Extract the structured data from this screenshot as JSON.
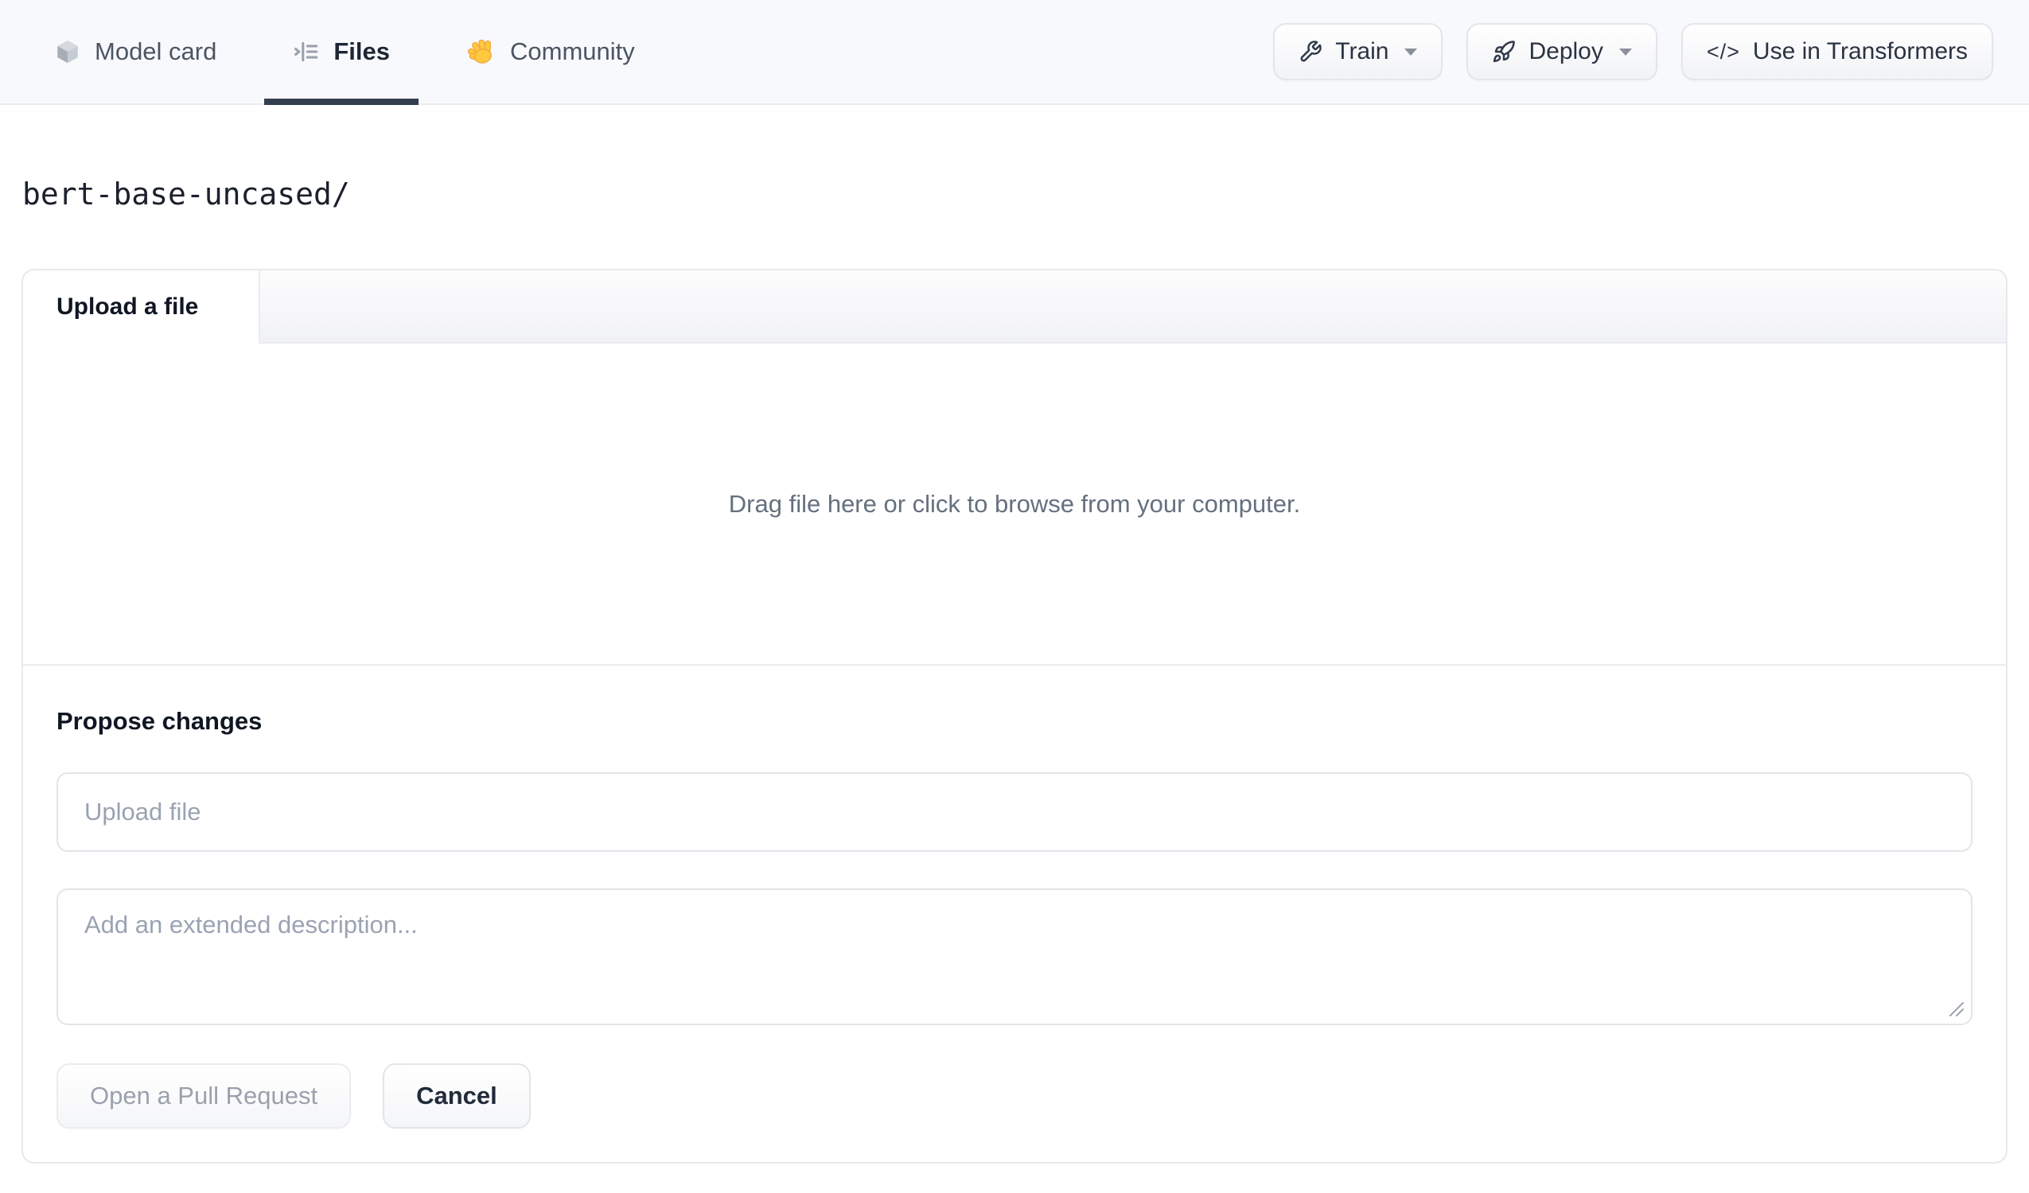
{
  "header": {
    "tabs": [
      {
        "label": "Model card",
        "icon": "cube-icon",
        "active": false
      },
      {
        "label": "Files",
        "icon": "file-tree-icon",
        "active": true
      },
      {
        "label": "Community",
        "icon": "waving-hand-icon",
        "active": false
      }
    ],
    "actions": [
      {
        "label": "Train",
        "icon": "wrench-icon",
        "has_caret": true
      },
      {
        "label": "Deploy",
        "icon": "rocket-icon",
        "has_caret": true
      },
      {
        "label": "Use in Transformers",
        "icon": "code-icon",
        "icon_text": "</>",
        "has_caret": false
      }
    ]
  },
  "breadcrumb": {
    "path": "bert-base-uncased/"
  },
  "upload_card": {
    "tab_label": "Upload a file",
    "dropzone_text": "Drag file here or click to browse from your computer.",
    "propose": {
      "heading": "Propose changes",
      "file_placeholder": "Upload file",
      "description_placeholder": "Add an extended description...",
      "submit_label": "Open a Pull Request",
      "cancel_label": "Cancel"
    }
  },
  "colors": {
    "topbar_bg": "#f8f9fc",
    "border": "#e9ebef",
    "active_tab_text": "#1d2634",
    "inactive_tab_text": "#4b5563",
    "active_tab_underline": "#333e51",
    "dropzone_text": "#65707f",
    "placeholder_text": "#9aa3b2",
    "disabled_button_text": "#99a1ad",
    "emoji_yellow": "#ffc83d"
  }
}
